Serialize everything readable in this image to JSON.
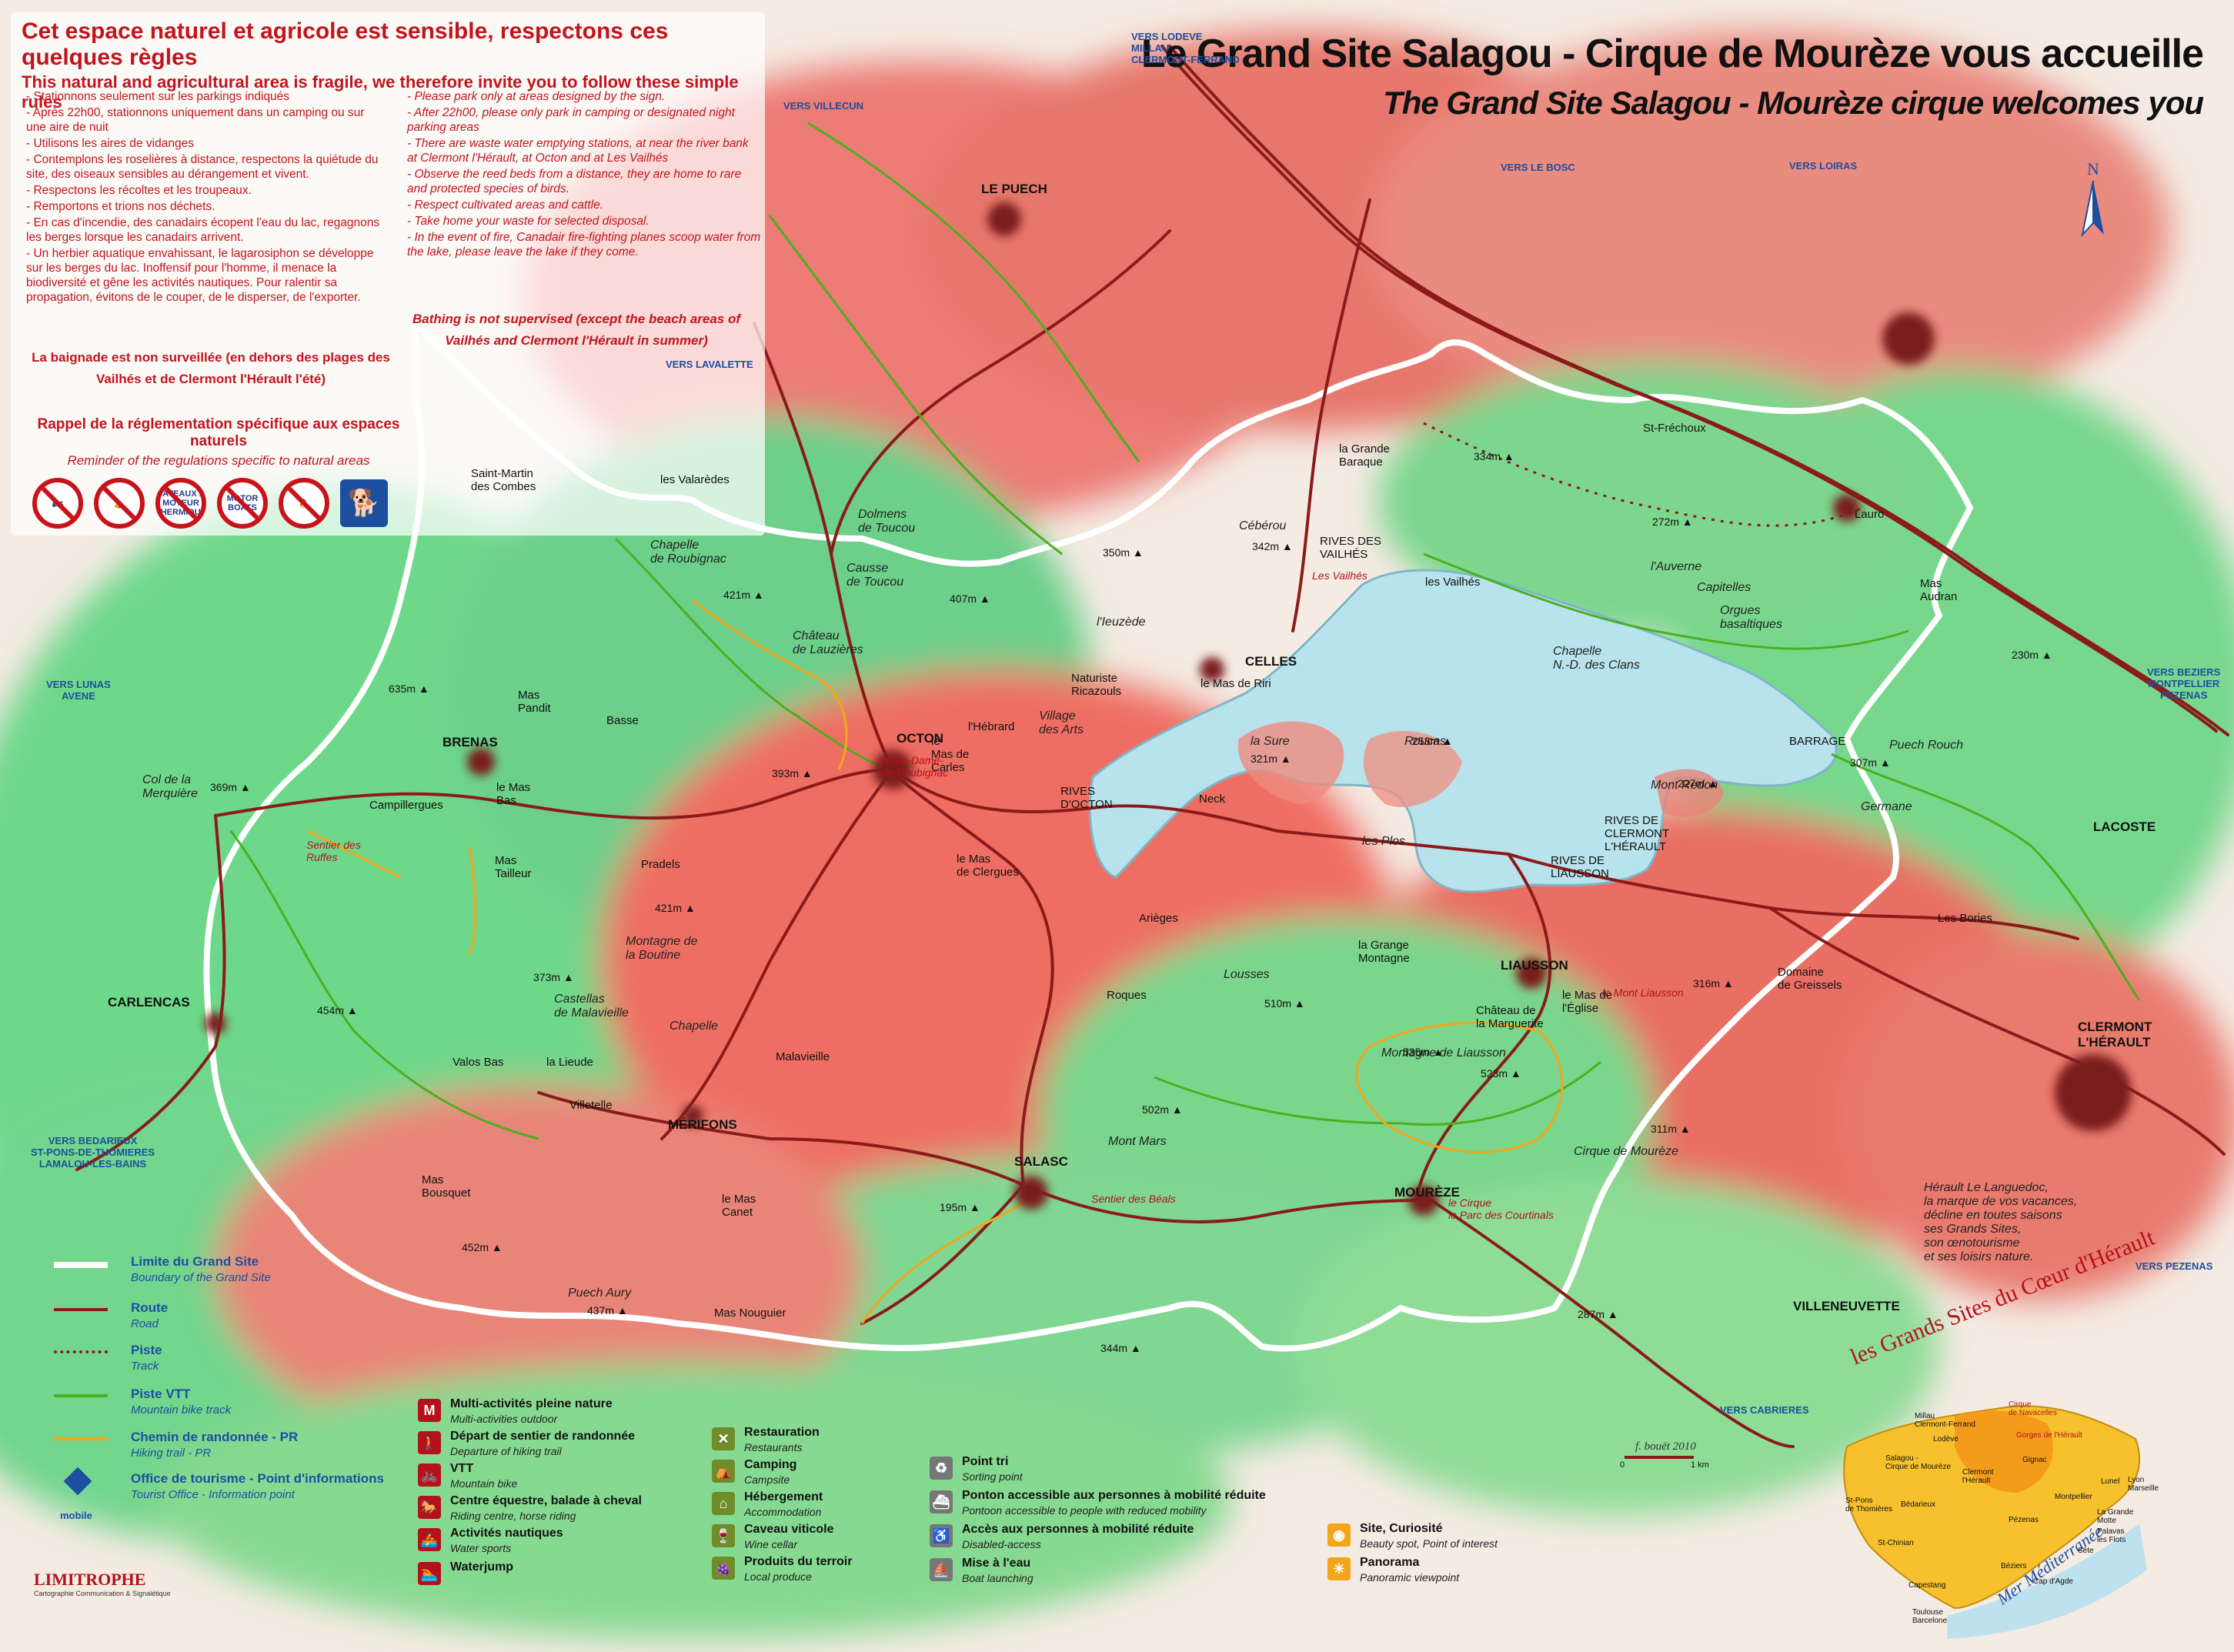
{
  "title": {
    "fr": "Le Grand Site Salagou - Cirque de Mourèze vous accueille",
    "en": "The Grand Site Salagou - Mourèze cirque welcomes you"
  },
  "rules": {
    "heading_fr": "Cet espace naturel et agricole est sensible, respectons ces quelques règles",
    "heading_en": "This natural and agricultural area is fragile, we therefore invite you to follow these simple rules",
    "items_fr": [
      "- Stationnons seulement sur les parkings indiqués",
      "- Après 22h00, stationnons uniquement dans un camping ou sur une aire de nuit",
      "- Utilisons les aires de vidanges",
      "- Contemplons les roselières à distance, respectons la quiétude du site, des oiseaux sensibles au dérangement et vivent.",
      "- Respectons les récoltes et les troupeaux.",
      "- Remportons et trions nos déchets.",
      "- En cas d'incendie, des canadairs écopent l'eau du lac, regagnons les berges lorsque les canadairs arrivent.",
      "- Un herbier aquatique envahissant, le lagarosiphon se développe sur les berges du lac. Inoffensif pour l'homme, il menace la biodiversité et gêne les activités nautiques. Pour ralentir sa propagation, évitons de le couper, de le disperser, de l'exporter."
    ],
    "items_en": [
      "- Please park only at areas designed by the sign.",
      "- After 22h00, please only park in camping or designated night parking areas",
      "- There are waste water emptying stations, at near the river bank at Clermont l'Hérault, at Octon and at Les Vailhés",
      "- Observe the reed beds from a distance, they are home to rare and protected species of birds.",
      "- Respect cultivated areas and cattle.",
      "- Take home your waste for selected disposal.",
      "- In the event of fire, Canadair fire-fighting planes scoop water from the lake, please leave the lake if they come."
    ],
    "bathing_en": "Bathing is not supervised (except the beach areas of Vailhés and Clermont l'Hérault in summer)",
    "bathing_fr": "La baignade est non surveillée (en dehors des plages des Vailhés et de Clermont l'Hérault l'été)",
    "reminder_fr": "Rappel de la réglementation spécifique aux espaces naturels",
    "reminder_en": "Reminder of the regulations specific to natural areas",
    "prohibited": [
      "",
      "",
      "BATEAUX À MOTEUR THERMIQUE",
      "MOTOR BOATS",
      ""
    ]
  },
  "directions": [
    {
      "label": "VERS LODEVE\nMILLAU\nCLERMONT-FERRAND"
    },
    {
      "label": "VERS VILLECUN"
    },
    {
      "label": "VERS LE BOSC"
    },
    {
      "label": "VERS LOIRAS"
    },
    {
      "label": "VERS LAVALETTE"
    },
    {
      "label": "VERS LUNAS\nAVENE"
    },
    {
      "label": "VERS BEZIERS\nMONTPELLIER\nPEZENAS"
    },
    {
      "label": "VERS BEDARIEUX\nST-PONS-DE-THOMIERES\nLAMALOU-LES-BAINS"
    },
    {
      "label": "VERS CABRIERES"
    },
    {
      "label": "VERS PEZENAS"
    }
  ],
  "places": [
    {
      "name": "LE PUECH",
      "cls": "big"
    },
    {
      "name": "OCTON",
      "cls": "big"
    },
    {
      "name": "CELLES",
      "cls": "big"
    },
    {
      "name": "BRENAS",
      "cls": "big"
    },
    {
      "name": "CARLENCAS",
      "cls": "big"
    },
    {
      "name": "MÉRIFONS",
      "cls": "big"
    },
    {
      "name": "SALASC",
      "cls": "big"
    },
    {
      "name": "MOURÈZE",
      "cls": "big"
    },
    {
      "name": "LIAUSSON",
      "cls": "big"
    },
    {
      "name": "LACOSTE",
      "cls": "big"
    },
    {
      "name": "VILLENEUVETTE",
      "cls": "big"
    },
    {
      "name": "CLERMONT\nL'HÉRAULT",
      "cls": "big"
    },
    {
      "name": "Saint-Martin\ndes Combes",
      "cls": ""
    },
    {
      "name": "les Valarèdes",
      "cls": ""
    },
    {
      "name": "Dolmens\nde Toucou",
      "cls": "it"
    },
    {
      "name": "Causse\nde Toucou",
      "cls": "it"
    },
    {
      "name": "Chapelle\nde Roubignac",
      "cls": "it"
    },
    {
      "name": "Château\nde Lauzières",
      "cls": "it"
    },
    {
      "name": "l'Ieuzède",
      "cls": "it"
    },
    {
      "name": "Cébérou",
      "cls": "it"
    },
    {
      "name": "la Grande\nBaraque",
      "cls": ""
    },
    {
      "name": "St-Fréchoux",
      "cls": ""
    },
    {
      "name": "Lauro",
      "cls": ""
    },
    {
      "name": "RIVES DES\nVAILHÉS",
      "cls": ""
    },
    {
      "name": "Les Vailhés",
      "cls": "red"
    },
    {
      "name": "les Vailhés",
      "cls": ""
    },
    {
      "name": "l'Auverne",
      "cls": "it"
    },
    {
      "name": "Capitelles",
      "cls": "it"
    },
    {
      "name": "Orgues\nbasaltiques",
      "cls": "it"
    },
    {
      "name": "Chapelle\nN.-D. des Clans",
      "cls": "it"
    },
    {
      "name": "Mas\nAudran",
      "cls": ""
    },
    {
      "name": "Mas\nPandit",
      "cls": ""
    },
    {
      "name": "Basse",
      "cls": ""
    },
    {
      "name": "Naturiste\nRicazouls",
      "cls": ""
    },
    {
      "name": "le Mas de Riri",
      "cls": ""
    },
    {
      "name": "l'Hébrard",
      "cls": ""
    },
    {
      "name": "Village\ndes Arts",
      "cls": "it"
    },
    {
      "name": "le\nMas de\nCarles",
      "cls": ""
    },
    {
      "name": "Notre-Dame-\nde-Roubignac",
      "cls": "red"
    },
    {
      "name": "RIVES\nD'OCTON",
      "cls": ""
    },
    {
      "name": "Neck",
      "cls": ""
    },
    {
      "name": "la Sure",
      "cls": "it"
    },
    {
      "name": "Roucas",
      "cls": "it"
    },
    {
      "name": "Mont Redon",
      "cls": "it"
    },
    {
      "name": "BARRAGE",
      "cls": ""
    },
    {
      "name": "Puech Rouch",
      "cls": "it"
    },
    {
      "name": "Germane",
      "cls": "it"
    },
    {
      "name": "RIVES DE\nCLERMONT\nL'HÉRAULT",
      "cls": ""
    },
    {
      "name": "RIVES DE\nLIAUSSON",
      "cls": ""
    },
    {
      "name": "les Plos",
      "cls": "it"
    },
    {
      "name": "Col de la\nMerquière",
      "cls": "it"
    },
    {
      "name": "Campillergues",
      "cls": ""
    },
    {
      "name": "le Mas\nBas",
      "cls": ""
    },
    {
      "name": "Mas\nTailleur",
      "cls": ""
    },
    {
      "name": "Sentier des\nRuffes",
      "cls": "red"
    },
    {
      "name": "Pradels",
      "cls": ""
    },
    {
      "name": "Montagne de\nla Boutine",
      "cls": "it"
    },
    {
      "name": "le Mas\nde Clergues",
      "cls": ""
    },
    {
      "name": "Arièges",
      "cls": ""
    },
    {
      "name": "Roques",
      "cls": ""
    },
    {
      "name": "Lousses",
      "cls": "it"
    },
    {
      "name": "la Grange\nMontagne",
      "cls": ""
    },
    {
      "name": "Château de\nla Marguerite",
      "cls": ""
    },
    {
      "name": "le Mas de\nl'Église",
      "cls": ""
    },
    {
      "name": "le Mont Liausson",
      "cls": "red"
    },
    {
      "name": "Domaine\nde Greissels",
      "cls": ""
    },
    {
      "name": "Les Bories",
      "cls": ""
    },
    {
      "name": "Castellas\nde Malavieille",
      "cls": "it"
    },
    {
      "name": "Chapelle",
      "cls": "it"
    },
    {
      "name": "Malavieille",
      "cls": ""
    },
    {
      "name": "Valos Bas",
      "cls": ""
    },
    {
      "name": "la Lieude",
      "cls": ""
    },
    {
      "name": "Villetelle",
      "cls": ""
    },
    {
      "name": "Mas\nBousquet",
      "cls": ""
    },
    {
      "name": "le Mas\nCanet",
      "cls": ""
    },
    {
      "name": "Mont Mars",
      "cls": "it"
    },
    {
      "name": "Sentier des Béals",
      "cls": "red"
    },
    {
      "name": "Montagne de Liausson",
      "cls": "it"
    },
    {
      "name": "Cirque de Mourèze",
      "cls": "it"
    },
    {
      "name": "le Cirque\nle Parc des Courtinals",
      "cls": "red"
    },
    {
      "name": "Puech Aury",
      "cls": "it"
    },
    {
      "name": "Mas Nouguier",
      "cls": ""
    },
    {
      "name": "Hérault Le Languedoc,\nla marque de vos vacances,\ndécline en toutes saisons\nses Grands Sites,\nson œnotourisme\net ses loisirs nature.",
      "cls": "it"
    }
  ],
  "altitudes": [
    "334m",
    "350m",
    "342m",
    "272m",
    "421m",
    "407m",
    "635m",
    "369m",
    "393m",
    "253m",
    "321m",
    "227m",
    "307m",
    "230m",
    "421m",
    "373m",
    "454m",
    "510m",
    "535m",
    "523m",
    "316m",
    "502m",
    "311m",
    "195m",
    "452m",
    "437m",
    "344m",
    "287m"
  ],
  "legend": {
    "lines": [
      {
        "fr": "Limite du Grand Site",
        "en": "Boundary of the Grand Site",
        "color": "#ffffff"
      },
      {
        "fr": "Route",
        "en": "Road",
        "color": "#8b1a1a"
      },
      {
        "fr": "Piste",
        "en": "Track",
        "color": "#8b1a1a"
      },
      {
        "fr": "Piste VTT",
        "en": "Mountain bike track",
        "color": "#4caf1f"
      },
      {
        "fr": "Chemin de randonnée - PR",
        "en": "Hiking trail - PR",
        "color": "#f3a51c"
      },
      {
        "fr": "Office de tourisme - Point d'informations",
        "en": "Tourist Office - Information point",
        "color": "#1c4fa0"
      }
    ],
    "icons_col1": [
      {
        "fr": "Multi-activités pleine nature",
        "en": "Multi-activities outdoor",
        "glyph": "M"
      },
      {
        "fr": "Départ de sentier de randonnée",
        "en": "Departure of hiking trail",
        "glyph": "🚶"
      },
      {
        "fr": "VTT",
        "en": "Mountain bike",
        "glyph": "🚲"
      },
      {
        "fr": "Centre équestre, balade à cheval",
        "en": "Riding centre, horse riding",
        "glyph": "🐎"
      },
      {
        "fr": "Activités nautiques",
        "en": "Water sports",
        "glyph": "🚣"
      },
      {
        "fr": "Waterjump",
        "en": "",
        "glyph": "🏊"
      }
    ],
    "icons_col2": [
      {
        "fr": "Restauration",
        "en": "Restaurants",
        "glyph": "✕"
      },
      {
        "fr": "Camping",
        "en": "Campsite",
        "glyph": "⛺"
      },
      {
        "fr": "Hébergement",
        "en": "Accommodation",
        "glyph": "⌂"
      },
      {
        "fr": "Caveau viticole",
        "en": "Wine cellar",
        "glyph": "🍷"
      },
      {
        "fr": "Produits du terroir",
        "en": "Local produce",
        "glyph": "🍇"
      }
    ],
    "icons_col3": [
      {
        "fr": "Point tri",
        "en": "Sorting point",
        "glyph": "♻"
      },
      {
        "fr": "Ponton accessible aux personnes à mobilité réduite",
        "en": "Pontoon accessible to people with reduced mobility",
        "glyph": "⛴"
      },
      {
        "fr": "Accès aux personnes à mobilité réduite",
        "en": "Disabled-access",
        "glyph": "♿"
      },
      {
        "fr": "Mise à l'eau",
        "en": "Boat launching",
        "glyph": "⛵"
      }
    ],
    "icons_col4": [
      {
        "fr": "Site, Curiosité",
        "en": "Beauty spot, Point of interest",
        "glyph": "◉"
      },
      {
        "fr": "Panorama",
        "en": "Panoramic viewpoint",
        "glyph": "☀"
      }
    ],
    "mobile_label": "mobile"
  },
  "scale": {
    "zero": "0",
    "km": "1 km"
  },
  "inset": {
    "arc_title": "les Grands Sites du Cœur d'Hérault",
    "sea": "Mer Méditerranée",
    "towns": [
      "Millau\nClermont-Ferrand",
      "Cirque\nde Navacelles",
      "Lodève",
      "Salagou -\nCirque de Mourèze",
      "Gorges de l'Hérault",
      "St-Pons\nde Thomières",
      "Bédarieux",
      "Clermont\nl'Hérault",
      "Gignac",
      "Montpellier",
      "Lunel",
      "Lyon\nMarseille",
      "La Grande\nMotte",
      "Palavas\nles Flots",
      "Sète",
      "Pézenas",
      "St-Chinian",
      "Béziers",
      "Cap d'Agde",
      "Capestang",
      "Toulouse\nBarcelone"
    ],
    "roads": [
      "A75",
      "A750",
      "A9",
      "A75"
    ]
  },
  "credit": {
    "brand": "LIMITROPHE",
    "sub": "Cartographie Communication & Signalétique",
    "signature": "f. bouët 2010"
  },
  "colors": {
    "boundary": "#ffffff",
    "road": "#8b1a1a",
    "vtt": "#4caf1f",
    "hike": "#f3a51c",
    "lake": "#a9d9e6",
    "brand_blue": "#1c4fa0",
    "rule_red": "#c2141d"
  }
}
